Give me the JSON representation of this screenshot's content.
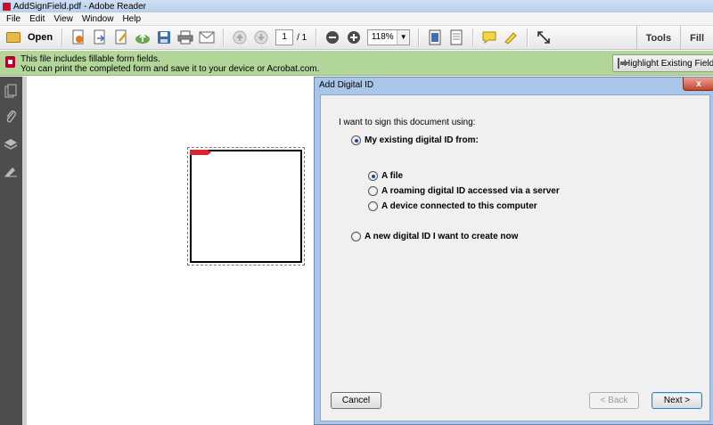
{
  "window": {
    "title": "AddSignField.pdf - Adobe Reader"
  },
  "menu": [
    "File",
    "Edit",
    "View",
    "Window",
    "Help"
  ],
  "toolbar": {
    "open_label": "Open",
    "page_current": "1",
    "page_total": "/ 1",
    "zoom": "118%",
    "tools_label": "Tools",
    "fill_label": "Fill",
    "icons": [
      "create-pdf-icon",
      "export-icon",
      "edit-icon",
      "cloud-upload-icon",
      "save-icon",
      "print-icon",
      "email-icon",
      "prev-page-icon",
      "next-page-icon",
      "zoom-out-icon",
      "zoom-in-icon",
      "zoom-dropdown-icon",
      "fit-page-icon",
      "read-mode-icon",
      "comment-icon",
      "highlight-icon",
      "full-screen-icon"
    ]
  },
  "notice": {
    "line1": "This file includes fillable form fields.",
    "line2": "You can print the completed form and save it to your device or Acrobat.com.",
    "highlight_button": "Highlight Existing Fields"
  },
  "sidebar": {
    "icons": [
      "pages-icon",
      "attachments-icon",
      "layers-icon",
      "signatures-icon"
    ]
  },
  "dialog": {
    "title": "Add Digital ID",
    "close_label": "x",
    "prompt": "I want to sign this document using:",
    "options": {
      "existing": {
        "label": "My existing digital ID from:",
        "checked": true
      },
      "file": {
        "label": "A file",
        "checked": true
      },
      "roaming": {
        "label": "A roaming digital ID accessed via a server",
        "checked": false
      },
      "device": {
        "label": "A device connected to this computer",
        "checked": false
      },
      "new_id": {
        "label": "A new digital ID I want to create now",
        "checked": false
      }
    },
    "buttons": {
      "cancel": "Cancel",
      "back": "< Back",
      "next": "Next >"
    }
  },
  "colors": {
    "notice_bar": "#b2d69a",
    "dialog_frame": "#a9c6e8",
    "sidebar": "#4d4d4d",
    "signature_flag": "#d8262e"
  }
}
